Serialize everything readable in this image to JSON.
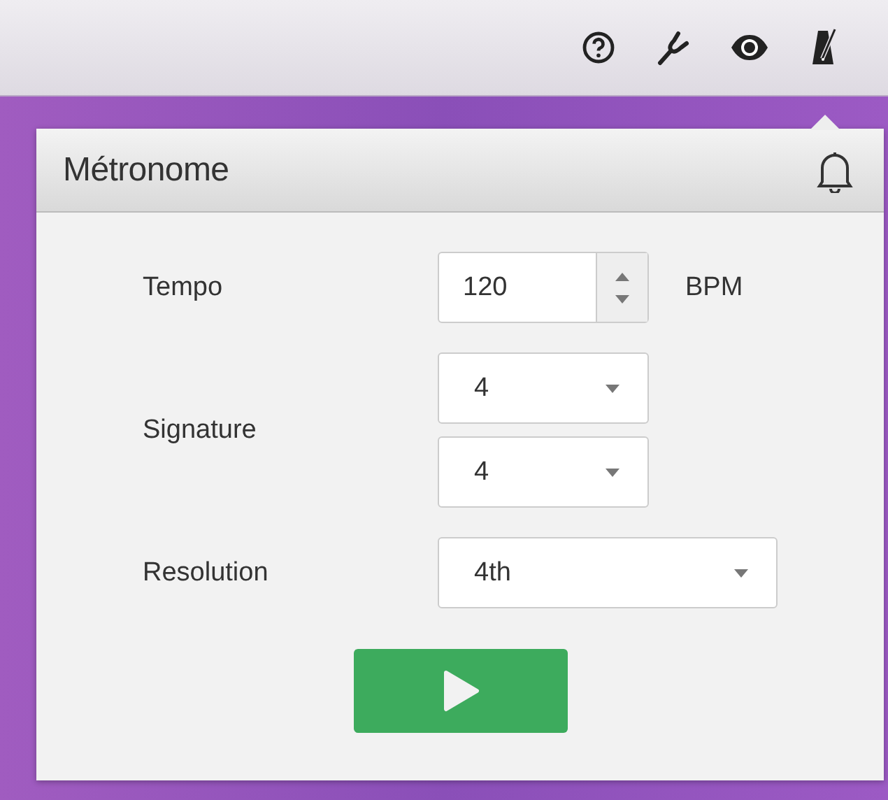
{
  "toolbar": {
    "items": [
      {
        "kind": "help",
        "selected": false
      },
      {
        "kind": "tuner",
        "selected": false
      },
      {
        "kind": "eye",
        "selected": false
      },
      {
        "kind": "metronome",
        "selected": true
      }
    ]
  },
  "panel": {
    "title": "Métronome",
    "tempo": {
      "label": "Tempo",
      "value": "120",
      "unit": "BPM"
    },
    "signature": {
      "label": "Signature",
      "beats": "4",
      "note": "4"
    },
    "resolution": {
      "label": "Resolution",
      "value": "4th"
    }
  }
}
